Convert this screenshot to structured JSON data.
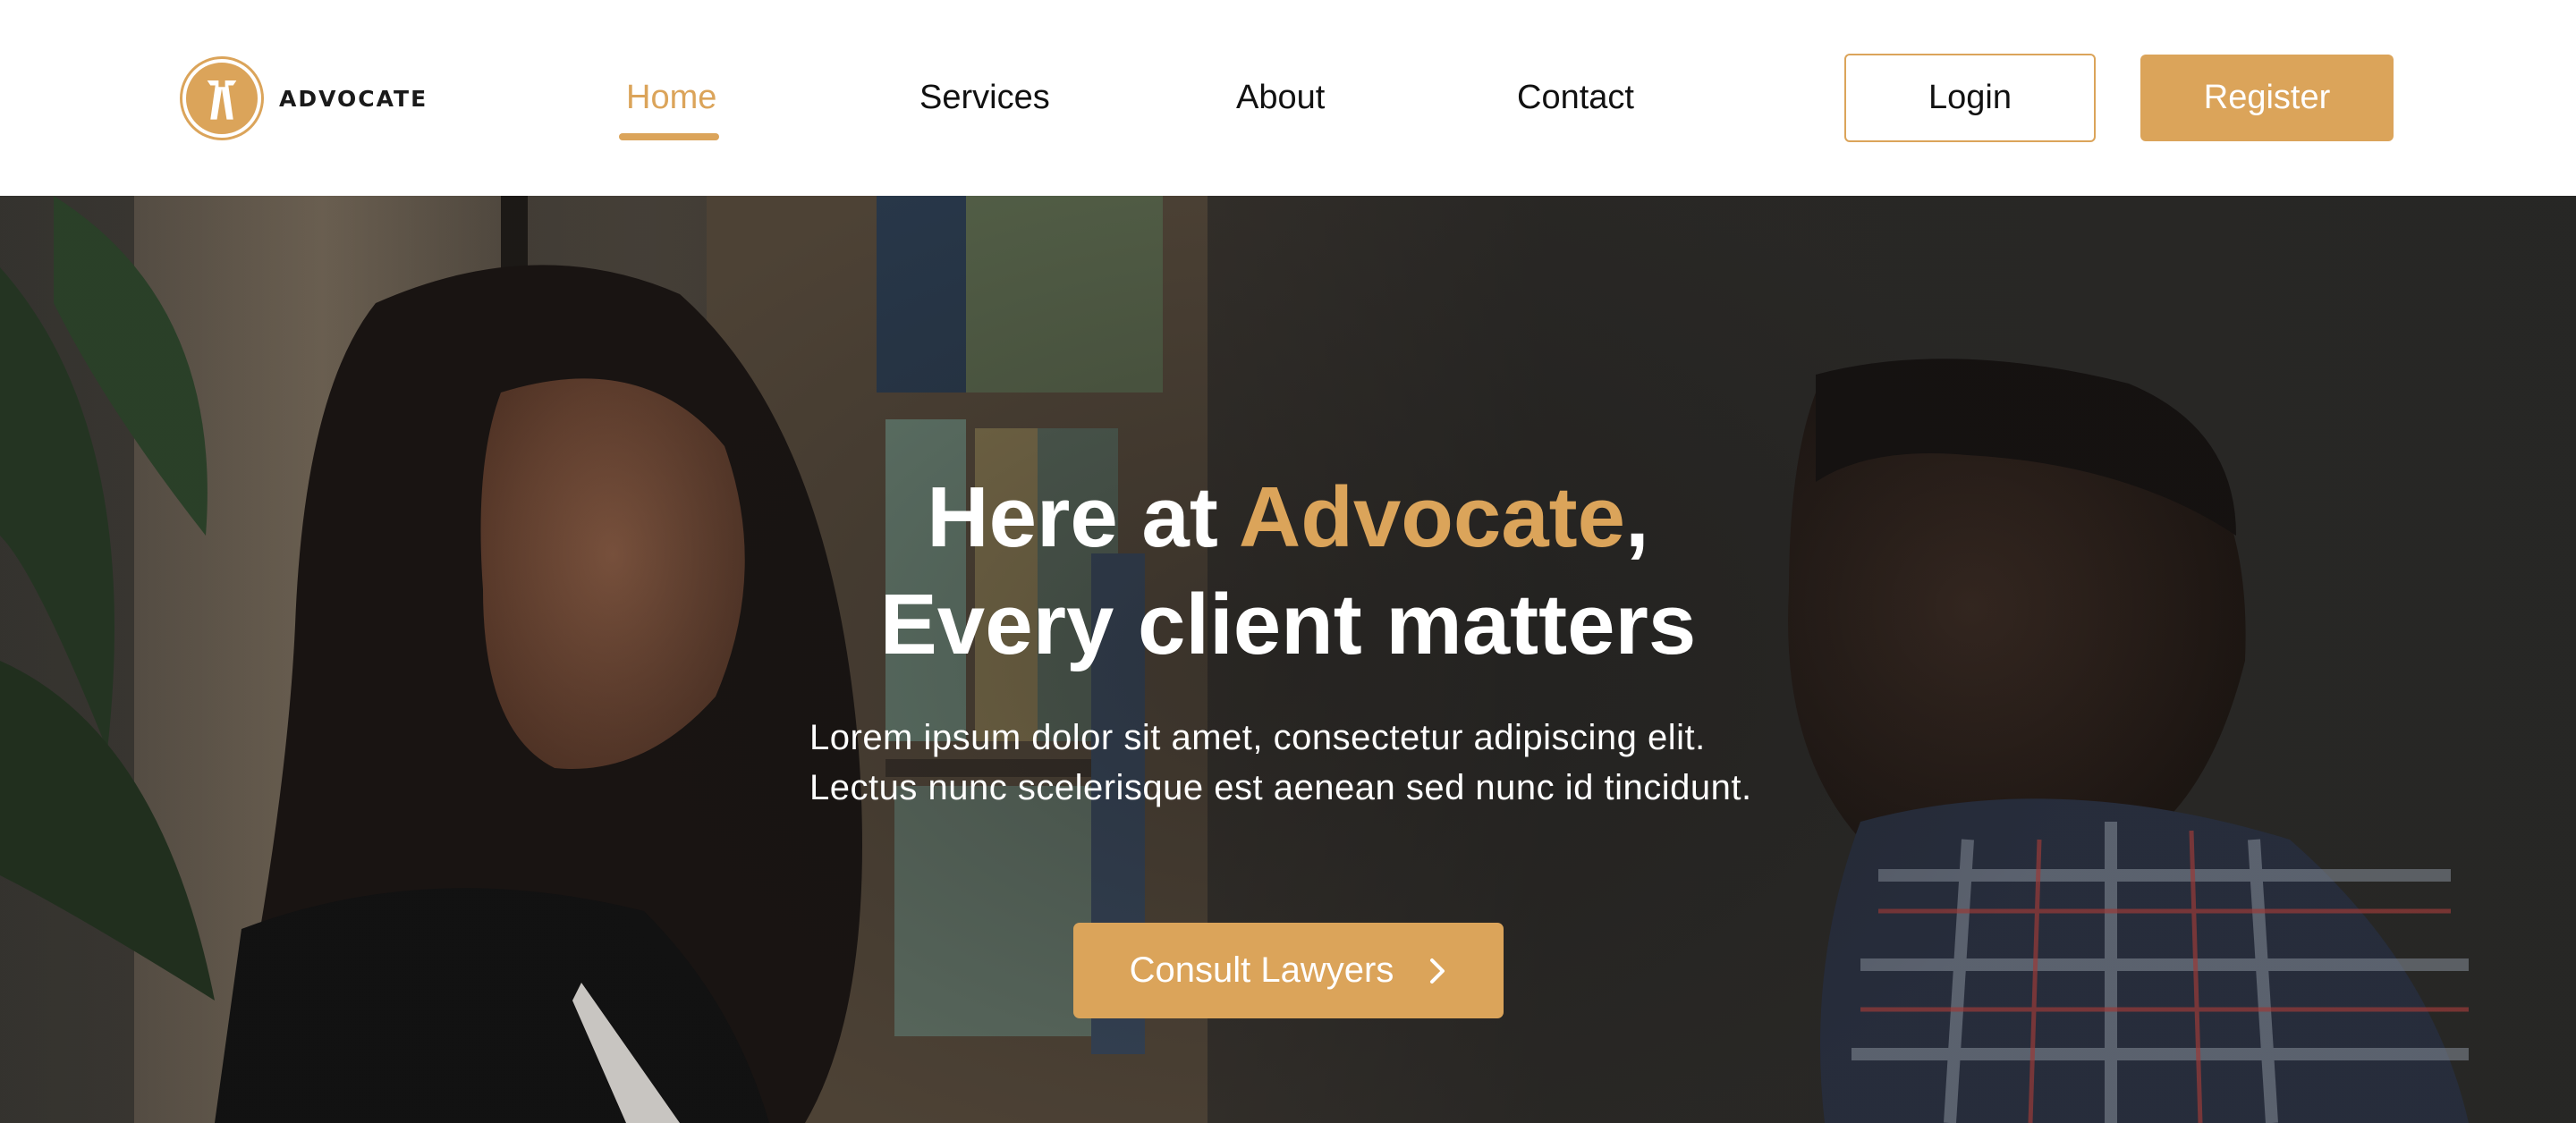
{
  "brand": {
    "name": "ADVOCATE",
    "logo_icon": "lawyer-bands-icon",
    "accent_color": "#dba45a"
  },
  "nav": {
    "items": [
      {
        "label": "Home",
        "active": true
      },
      {
        "label": "Services",
        "active": false
      },
      {
        "label": "About",
        "active": false
      },
      {
        "label": "Contact",
        "active": false
      }
    ]
  },
  "auth": {
    "login_label": "Login",
    "register_label": "Register"
  },
  "hero": {
    "title_prefix": "Here at ",
    "title_accent": "Advocate",
    "title_suffix": ",",
    "title_line2": "Every client matters",
    "subtitle_line1": "Lorem ipsum dolor sit amet, consectetur adipiscing elit.",
    "subtitle_line2": "Lectus nunc scelerisque est aenean sed nunc id tincidunt.",
    "cta_label": "Consult Lawyers",
    "cta_icon": "chevron-right-icon"
  }
}
